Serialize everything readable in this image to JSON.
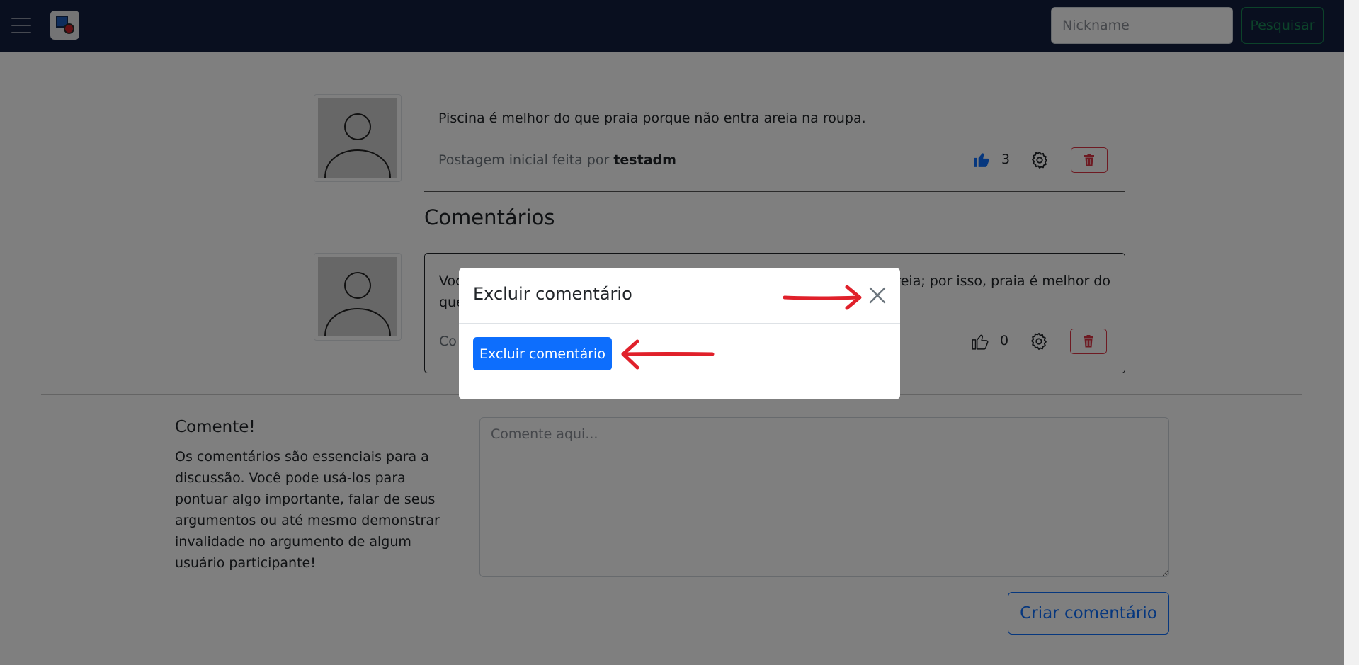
{
  "navbar": {
    "search_placeholder": "Nickname",
    "search_button": "Pesquisar"
  },
  "post": {
    "text": "Piscina é melhor do que praia porque não entra areia na roupa.",
    "meta_prefix": "Postagem inicial feita por",
    "author": "testadm",
    "likes": "3"
  },
  "comments": {
    "title": "Comentários",
    "items": [
      {
        "text_start": "Voc",
        "text_end": "areia; por isso, praia é melhor do",
        "text_line2": "que",
        "meta_partial": "Co",
        "likes": "0"
      }
    ]
  },
  "comment_form": {
    "title": "Comente!",
    "description": "Os comentários são essenciais para a discussão. Você pode usá-los para pontuar algo importante, falar de seus argumentos ou até mesmo demonstrar invalidade no argumento de algum usuário participante!",
    "placeholder": "Comente aqui...",
    "submit": "Criar comentário"
  },
  "modal": {
    "title": "Excluir comentário",
    "confirm_button": "Excluir comentário"
  },
  "colors": {
    "navbar": "#131f3f",
    "primary": "#0d6efd",
    "success": "#198754",
    "danger": "#dc3545",
    "annotation": "#e0202a"
  }
}
